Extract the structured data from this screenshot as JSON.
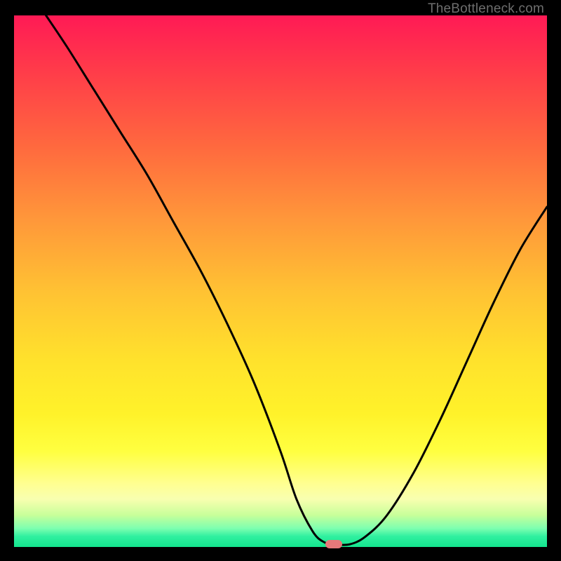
{
  "watermark": "TheBottleneck.com",
  "colors": {
    "page_bg": "#000000",
    "curve_stroke": "#000000",
    "marker_fill": "#e6787a"
  },
  "chart_data": {
    "type": "line",
    "title": "",
    "xlabel": "",
    "ylabel": "",
    "xlim": [
      0,
      100
    ],
    "ylim": [
      0,
      100
    ],
    "legend": false,
    "grid": false,
    "series": [
      {
        "name": "bottleneck-curve",
        "x": [
          6,
          10,
          15,
          20,
          25,
          30,
          35,
          40,
          45,
          50,
          53,
          56,
          58,
          60,
          63,
          66,
          70,
          75,
          80,
          85,
          90,
          95,
          100
        ],
        "y": [
          100,
          94,
          86,
          78,
          70,
          61,
          52,
          42,
          31,
          18,
          9,
          3,
          1,
          0.5,
          0.5,
          2,
          6,
          14,
          24,
          35,
          46,
          56,
          64
        ]
      }
    ],
    "marker": {
      "x": 60,
      "y": 0.5
    },
    "background_gradient": {
      "stops": [
        {
          "pos": 0.0,
          "color": "#ff1a55"
        },
        {
          "pos": 0.25,
          "color": "#ff6a3e"
        },
        {
          "pos": 0.52,
          "color": "#ffc233"
        },
        {
          "pos": 0.82,
          "color": "#ffff40"
        },
        {
          "pos": 0.94,
          "color": "#c8ff9a"
        },
        {
          "pos": 1.0,
          "color": "#14e58e"
        }
      ]
    }
  }
}
